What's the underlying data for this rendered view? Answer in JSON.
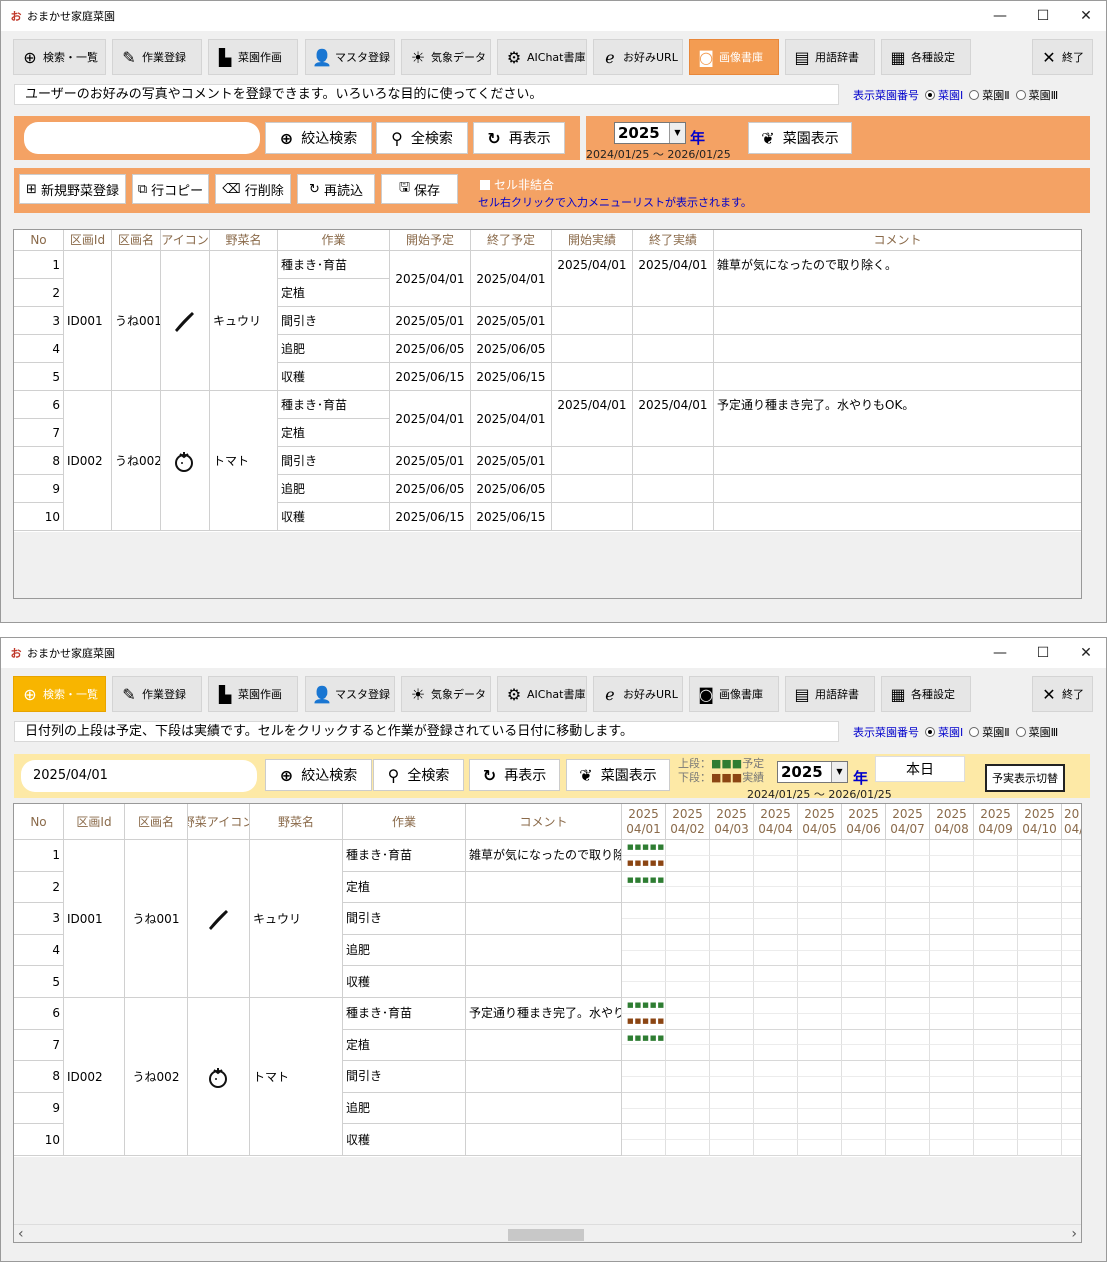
{
  "app": {
    "title": "おまかせ家庭菜園",
    "minimize": "—",
    "maximize": "☐",
    "close": "✕",
    "logo": "お"
  },
  "toolbar": {
    "search": "検索・一覧",
    "work": "作業登録",
    "garden": "菜園作画",
    "master": "マスタ登録",
    "weather": "気象データ",
    "aichat": "AIChat書庫",
    "url": "お好みURL",
    "image": "画像書庫",
    "dict": "用語辞書",
    "settings": "各種設定",
    "exit": "終了"
  },
  "garden_select": {
    "label": "表示菜園番号",
    "opt1": "菜園Ⅰ",
    "opt2": "菜園Ⅱ",
    "opt3": "菜園Ⅲ"
  },
  "w1": {
    "message": "ユーザーのお好みの写真やコメントを登録できます。いろいろな目的に使ってください。",
    "search_value": "",
    "btn_filter": "絞込検索",
    "btn_all": "全検索",
    "btn_refresh": "再表示",
    "btn_garden": "菜園表示",
    "year": "2025",
    "year_unit": "年",
    "range": "2024/01/25 ～ 2026/01/25",
    "btn_new": "新規野菜登録",
    "btn_copy": "行コピー",
    "btn_delete": "行削除",
    "btn_reload": "再読込",
    "btn_save": "保存",
    "chk_label": "セル非結合",
    "hint": "セル右クリックで入力メニューリストが表示されます。",
    "columns": [
      "No",
      "区画Id",
      "区画名",
      "アイコン",
      "野菜名",
      "作業",
      "開始予定",
      "終了予定",
      "開始実績",
      "終了実績",
      "コメント"
    ],
    "nos": [
      "1",
      "2",
      "3",
      "4",
      "5",
      "6",
      "7",
      "8",
      "9",
      "10"
    ],
    "groups": [
      {
        "id": "ID001",
        "name": "うね001",
        "veg": "キュウリ",
        "icon": "cucumber-icon"
      },
      {
        "id": "ID002",
        "name": "うね002",
        "veg": "トマト",
        "icon": "tomato-icon"
      }
    ],
    "tasks": [
      "種まき･育苗",
      "定植",
      "間引き",
      "追肥",
      "収穫"
    ],
    "plan": [
      [
        "2025/04/01",
        "2025/04/01"
      ],
      [
        "2025/05/01",
        "2025/05/01"
      ],
      [
        "2025/06/05",
        "2025/06/05"
      ],
      [
        "2025/06/15",
        "2025/06/15"
      ]
    ],
    "actual": [
      [
        "2025/04/01",
        "2025/04/01"
      ],
      [
        "2025/04/01",
        "2025/04/01"
      ]
    ],
    "comments": [
      "雑草が気になったので取り除く。",
      "予定通り種まき完了。水やりもOK。"
    ]
  },
  "w2": {
    "message": "日付列の上段は予定、下段は実績です。セルをクリックすると作業が登録されている日付に移動します。",
    "search_value": "2025/04/01",
    "btn_filter": "絞込検索",
    "btn_all": "全検索",
    "btn_refresh": "再表示",
    "btn_garden": "菜園表示",
    "legend_plan_label": "上段：",
    "legend_plan": "予定",
    "legend_act_label": "下段：",
    "legend_act": "実績",
    "legend_dots": "■■■",
    "year": "2025",
    "year_unit": "年",
    "range": "2024/01/25 ～ 2026/01/25",
    "btn_today": "本日",
    "btn_toggle": "予実表示切替",
    "columns": [
      "No",
      "区画Id",
      "区画名",
      "野菜アイコン",
      "野菜名",
      "作業",
      "コメント"
    ],
    "date_year": "2025",
    "dates": [
      "04/01",
      "04/02",
      "04/03",
      "04/04",
      "04/05",
      "04/06",
      "04/07",
      "04/08",
      "04/09",
      "04/10"
    ],
    "cut_year": "20",
    "cut_date": "04/",
    "comment1": "雑草が気になったので取り除く。",
    "comment2": "予定通り種まき完了。水やりもOK。",
    "dots": "■■■■■",
    "scroll_left": "‹",
    "scroll_right": "›"
  },
  "colors": {
    "accent_orange": "#f4a264",
    "accent_yellow": "#f8b500",
    "link_blue": "#0000cc",
    "plan_green": "#2e7d32",
    "actual_brown": "#8b4513"
  }
}
